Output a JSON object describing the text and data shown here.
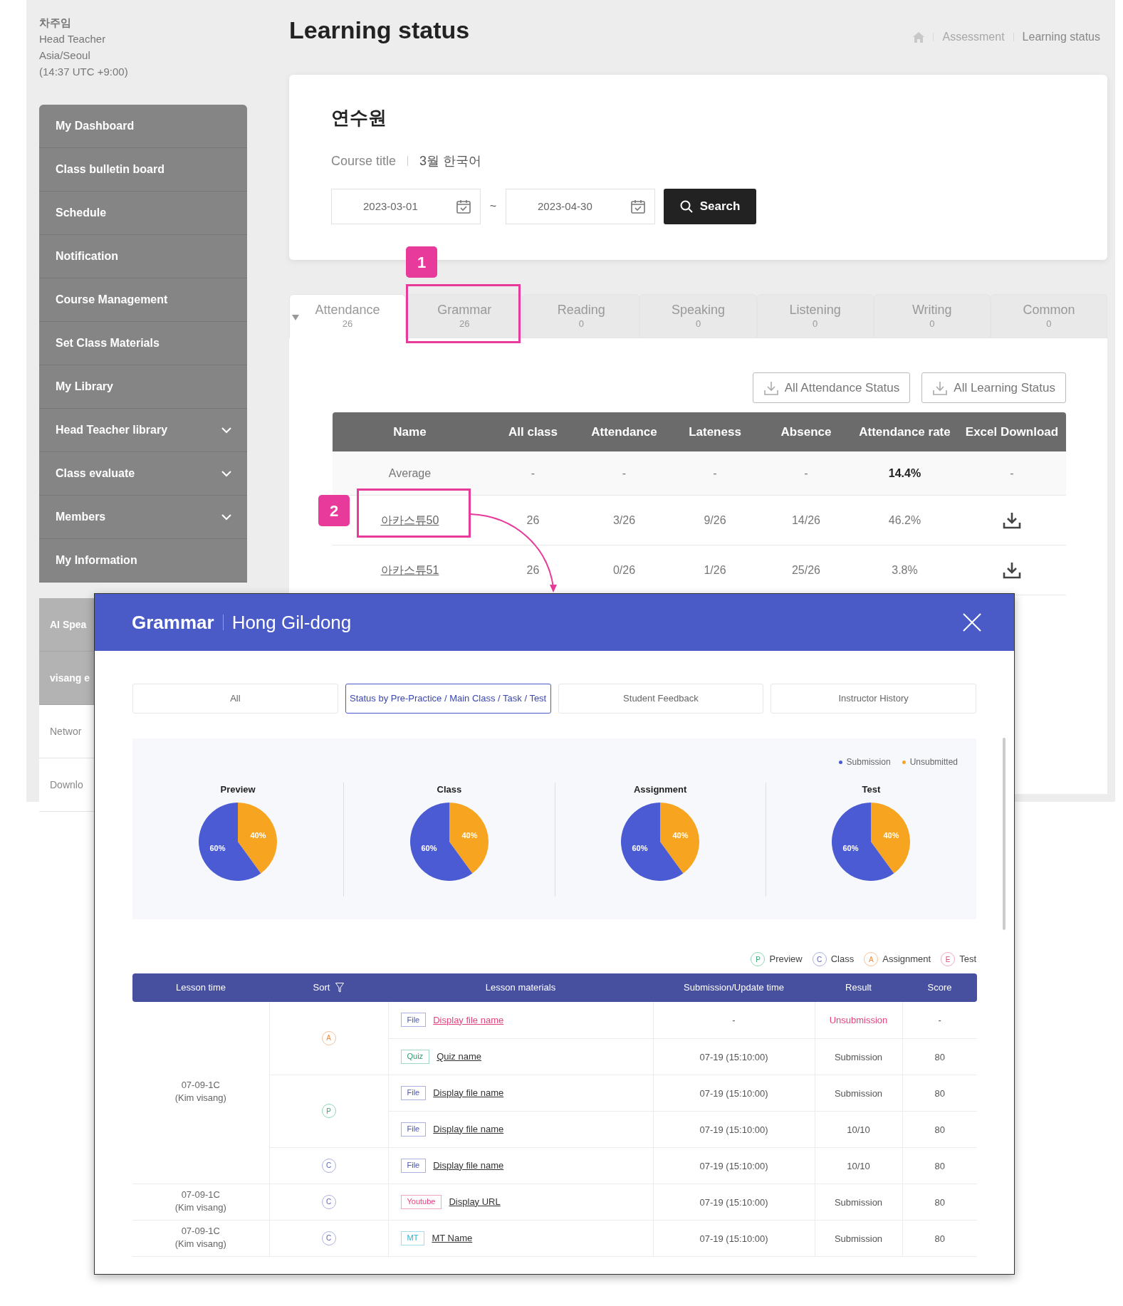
{
  "user": {
    "name": "차주임",
    "role": "Head Teacher",
    "timezone": "Asia/Seoul",
    "time": "(14:37 UTC +9:00)"
  },
  "sidebar": {
    "items": [
      {
        "label": "My Dashboard",
        "kind": "menu",
        "expandable": false
      },
      {
        "label": "Class bulletin board",
        "kind": "menu",
        "expandable": false
      },
      {
        "label": "Schedule",
        "kind": "menu",
        "expandable": false
      },
      {
        "label": "Notification",
        "kind": "menu",
        "expandable": false
      },
      {
        "label": "Course Management",
        "kind": "menu",
        "expandable": false
      },
      {
        "label": "Set Class Materials",
        "kind": "menu",
        "expandable": false
      },
      {
        "label": "My Library",
        "kind": "menu",
        "expandable": false
      },
      {
        "label": "Head Teacher library",
        "kind": "menu",
        "expandable": true
      },
      {
        "label": "Class evaluate",
        "kind": "menu",
        "expandable": true
      },
      {
        "label": "Members",
        "kind": "menu",
        "expandable": true
      },
      {
        "label": "My Information",
        "kind": "menu",
        "expandable": false
      },
      {
        "label": "AI Spea",
        "kind": "partner"
      },
      {
        "label": "visang e",
        "kind": "partner"
      },
      {
        "label": "Networ",
        "kind": "link"
      },
      {
        "label": "Downlo",
        "kind": "link"
      }
    ]
  },
  "page": {
    "title": "Learning status",
    "breadcrumb": [
      "Assessment",
      "Learning status"
    ]
  },
  "filter": {
    "organization": "연수원",
    "course_label": "Course title",
    "course": "3월 한국어",
    "start_date": "2023-03-01",
    "separator": "~",
    "end_date": "2023-04-30",
    "search_button": "Search"
  },
  "tabs": [
    {
      "label": "Attendance",
      "count": "26",
      "selected": true
    },
    {
      "label": "Grammar",
      "count": "26",
      "selected": false
    },
    {
      "label": "Reading",
      "count": "0",
      "selected": false
    },
    {
      "label": "Speaking",
      "count": "0",
      "selected": false
    },
    {
      "label": "Listening",
      "count": "0",
      "selected": false
    },
    {
      "label": "Writing",
      "count": "0",
      "selected": false
    },
    {
      "label": "Common",
      "count": "0",
      "selected": false
    }
  ],
  "downloads": [
    "All Attendance Status",
    "All Learning Status"
  ],
  "table": {
    "columns": [
      "Name",
      "All class",
      "Attendance",
      "Lateness",
      "Absence",
      "Attendance rate",
      "Excel Download"
    ],
    "rows": [
      {
        "kind": "average",
        "cells": [
          "Average",
          "-",
          "-",
          "-",
          "-",
          "14.4%",
          "-"
        ]
      },
      {
        "kind": "student",
        "cells": [
          "아카스튜50",
          "26",
          "3/26",
          "9/26",
          "14/26",
          "46.2%"
        ]
      },
      {
        "kind": "student",
        "cells": [
          "아카스튜51",
          "26",
          "0/26",
          "1/26",
          "25/26",
          "3.8%"
        ]
      }
    ]
  },
  "annotations": [
    "1",
    "2"
  ],
  "modal": {
    "title": "Grammar",
    "student": "Hong Gil-dong",
    "tabs": [
      {
        "label": "All",
        "selected": false
      },
      {
        "label": "Status by Pre-Practice / Main Class / Task / Test",
        "selected": true
      },
      {
        "label": "Student Feedback",
        "selected": false
      },
      {
        "label": "Instructor History",
        "selected": false
      }
    ],
    "legend": [
      {
        "label": "Submission",
        "color": "#4a5bd4"
      },
      {
        "label": "Unsubmitted",
        "color": "#f7a520"
      }
    ],
    "charts": [
      {
        "chart_data": {
          "type": "pie",
          "title": "Preview",
          "values": [
            60,
            40
          ],
          "value_labels": [
            "60%",
            "40%"
          ]
        }
      },
      {
        "chart_data": {
          "type": "pie",
          "title": "Class",
          "values": [
            60,
            40
          ],
          "value_labels": [
            "60%",
            "40%"
          ]
        }
      },
      {
        "chart_data": {
          "type": "pie",
          "title": "Assignment",
          "values": [
            60,
            40
          ],
          "value_labels": [
            "60%",
            "40%"
          ]
        }
      },
      {
        "chart_data": {
          "type": "pie",
          "title": "Test",
          "values": [
            60,
            40
          ],
          "value_labels": [
            "60%",
            "40%"
          ]
        }
      }
    ],
    "sort_legend": [
      {
        "letter": "P",
        "label": "Preview",
        "kind": "preview"
      },
      {
        "letter": "C",
        "label": "Class",
        "kind": "class"
      },
      {
        "letter": "A",
        "label": "Assignment",
        "kind": "assignment"
      },
      {
        "letter": "E",
        "label": "Test",
        "kind": "test"
      }
    ],
    "table": {
      "columns": [
        "Lesson time",
        "Sort",
        "Lesson materials",
        "Submission/Update time",
        "Result",
        "Score"
      ],
      "groups": [
        {
          "lesson": "07-09-1C",
          "instructor": "(Kim visang)",
          "sorts": [
            {
              "letter": "A",
              "kind": "assignment",
              "items": [
                {
                  "tag": "File",
                  "kind": "file",
                  "name": "Display file name",
                  "time": "-",
                  "result": "Unsubmission",
                  "submitted": false,
                  "score": "-"
                },
                {
                  "tag": "Quiz",
                  "kind": "quiz",
                  "name": "Quiz name",
                  "time": "07-19 (15:10:00)",
                  "result": "Submission",
                  "submitted": true,
                  "score": "80"
                }
              ]
            },
            {
              "letter": "P",
              "kind": "preview",
              "items": [
                {
                  "tag": "File",
                  "kind": "file",
                  "name": "Display file name",
                  "time": "07-19 (15:10:00)",
                  "result": "Submission",
                  "submitted": true,
                  "score": "80"
                },
                {
                  "tag": "File",
                  "kind": "file",
                  "name": "Display file name",
                  "time": "07-19 (15:10:00)",
                  "result": "10/10",
                  "submitted": true,
                  "score": "80"
                }
              ]
            },
            {
              "letter": "C",
              "kind": "class",
              "items": [
                {
                  "tag": "File",
                  "kind": "file",
                  "name": "Display file name",
                  "time": "07-19 (15:10:00)",
                  "result": "10/10",
                  "submitted": true,
                  "score": "80"
                }
              ]
            }
          ]
        },
        {
          "lesson": "07-09-1C",
          "instructor": "(Kim visang)",
          "sorts": [
            {
              "letter": "C",
              "kind": "class",
              "items": [
                {
                  "tag": "Youtube",
                  "kind": "youtube",
                  "name": "Display URL",
                  "time": "07-19 (15:10:00)",
                  "result": "Submission",
                  "submitted": true,
                  "score": "80"
                }
              ]
            }
          ]
        },
        {
          "lesson": "07-09-1C",
          "instructor": "(Kim visang)",
          "sorts": [
            {
              "letter": "C",
              "kind": "class",
              "items": [
                {
                  "tag": "MT",
                  "kind": "mt",
                  "name": "MT Name",
                  "time": "07-19 (15:10:00)",
                  "result": "Submission",
                  "submitted": true,
                  "score": "80"
                }
              ]
            }
          ]
        }
      ]
    }
  }
}
